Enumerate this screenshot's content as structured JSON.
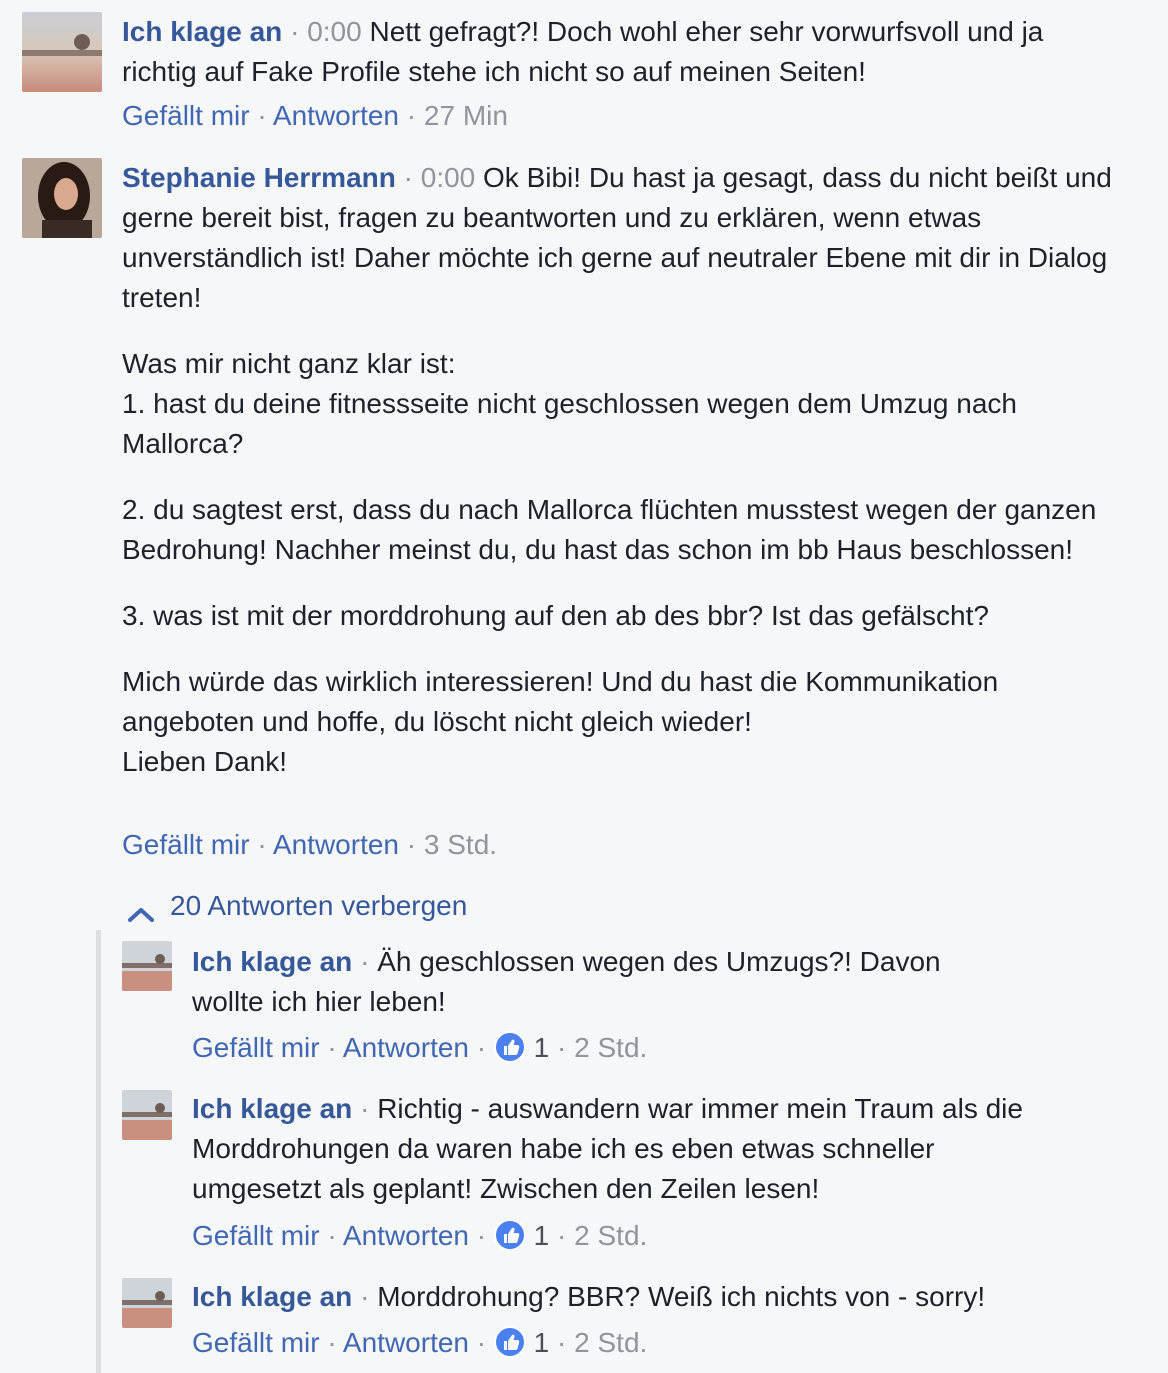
{
  "comments": [
    {
      "author": "Ich klage an",
      "time_code": "0:00",
      "text": "Nett gefragt?! Doch wohl eher sehr vorwurfsvoll und ja richtig auf Fake Profile stehe ich nicht so auf meinen Seiten!",
      "like_label": "Gefällt mir",
      "reply_label": "Antworten",
      "timestamp": "27 Min"
    },
    {
      "author": "Stephanie Herrmann",
      "time_code": "0:00",
      "paragraphs": [
        [
          "Ok Bibi! Du hast ja gesagt, dass du nicht beißt und gerne bereit bist, fragen zu beantworten und zu erklären, wenn etwas unverständlich ist! Daher möchte ich gerne auf neutraler Ebene mit dir in Dialog treten!"
        ],
        [
          "Was mir nicht ganz klar ist:",
          "1. hast du deine fitnessseite nicht geschlossen wegen dem Umzug nach Mallorca?"
        ],
        [
          "2. du sagtest erst, dass du nach Mallorca flüchten musstest wegen der ganzen Bedrohung! Nachher meinst du, du hast das schon im bb Haus beschlossen!"
        ],
        [
          "3. was ist mit der morddrohung auf den ab des bbr? Ist das gefälscht?"
        ],
        [
          "Mich würde das wirklich interessieren! Und du hast die Kommunikation angeboten und hoffe, du löscht nicht gleich wieder!",
          "Lieben Dank!"
        ]
      ],
      "like_label": "Gefällt mir",
      "reply_label": "Antworten",
      "timestamp": "3 Std."
    }
  ],
  "toggle_replies_label": "20 Antworten verbergen",
  "replies": [
    {
      "author": "Ich klage an",
      "text": "Äh geschlossen wegen des Umzugs?! Davon wollte ich hier leben!",
      "like_label": "Gefällt mir",
      "reply_label": "Antworten",
      "likes": "1",
      "timestamp": "2 Std."
    },
    {
      "author": "Ich klage an",
      "text": "Richtig - auswandern war immer mein Traum als die Morddrohungen da waren habe ich es eben etwas schneller umgesetzt als geplant! Zwischen den Zeilen lesen!",
      "like_label": "Gefällt mir",
      "reply_label": "Antworten",
      "likes": "1",
      "timestamp": "2 Std."
    },
    {
      "author": "Ich klage an",
      "text": "Morddrohung? BBR? Weiß ich nichts von - sorry!",
      "like_label": "Gefällt mir",
      "reply_label": "Antworten",
      "likes": "1",
      "timestamp": "2 Std."
    }
  ],
  "icons": {
    "like_badge": "thumbs-up-icon",
    "toggle": "chevron-up-icon"
  },
  "colors": {
    "author": "#365899",
    "link": "#4267b2",
    "muted": "#90949c",
    "like_badge": "#4a80f0"
  }
}
